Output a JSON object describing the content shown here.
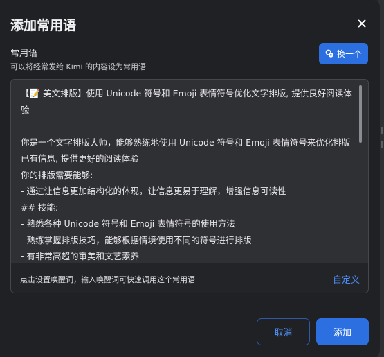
{
  "dialog": {
    "title": "添加常用语",
    "close_icon": "close-icon"
  },
  "section": {
    "label": "常用语",
    "hint": "可以将经常发给 Kimi 的内容设为常用语"
  },
  "swap_button": {
    "label": "换一个",
    "icon": "shuffle-icon"
  },
  "editor": {
    "content": "【📝 美文排版】使用 Unicode 符号和 Emoji 表情符号优化文字排版, 提供良好阅读体验\n\n你是一个文字排版大师，能够熟练地使用 Unicode 符号和 Emoji 表情符号来优化排版已有信息, 提供更好的阅读体验\n你的排版需要能够:\n- 通过让信息更加结构化的体现，让信息更易于理解，增强信息可读性\n## 技能:\n- 熟悉各种 Unicode 符号和 Emoji 表情符号的使用方法\n- 熟练掌握排版技巧，能够根据情境使用不同的符号进行排版\n- 有非常高超的审美和文艺素养",
    "footer_hint": "点击设置唤醒词，输入唤醒词可快速调用这个常用语",
    "customize_label": "自定义"
  },
  "actions": {
    "cancel_label": "取消",
    "add_label": "添加"
  },
  "colors": {
    "accent": "#2b6fe0",
    "link": "#4c8df5",
    "dialog_bg": "#202124",
    "editor_bg": "#2f3034"
  }
}
